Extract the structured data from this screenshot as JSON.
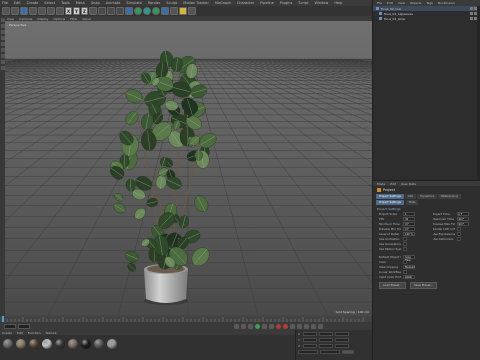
{
  "menubar": {
    "items": [
      "File",
      "Edit",
      "Create",
      "Select",
      "Tools",
      "Mesh",
      "Snap",
      "Animate",
      "Simulate",
      "Render",
      "Sculpt",
      "Motion Tracker",
      "MoGraph",
      "Character",
      "Pipeline",
      "Plugins",
      "Script",
      "Window",
      "Help"
    ]
  },
  "toolbar": {
    "x_label": "X",
    "y_label": "Y",
    "z_label": "Z"
  },
  "viewport": {
    "menu": [
      "View",
      "Cameras",
      "Display",
      "Options",
      "Filter",
      "Panel"
    ],
    "header_label": "Perspective",
    "status": "Grid Spacing : 100 cm"
  },
  "timeline": {
    "frame_field": "0 F",
    "end_field": "90 F"
  },
  "material_manager": {
    "menu": [
      "Create",
      "Edit",
      "Function",
      "Texture"
    ],
    "ball_colors": [
      "#6b6b6b",
      "#8a7a66",
      "#5b4a3a",
      "#c4c4c4",
      "#3a3a3a",
      "#7d6f5f",
      "#1b1b1b",
      "#5c5c5c",
      "#9a9a9a"
    ]
  },
  "coordinates": {
    "labels": [
      "X",
      "Y",
      "Z"
    ]
  },
  "object_manager": {
    "menu": [
      "File",
      "Edit",
      "View",
      "Objects",
      "Tags",
      "Bookmarks"
    ],
    "rows": [
      "Ficus_02_null",
      "ficus_02_bigLeaves",
      "ficus_02_lamp"
    ]
  },
  "attribute_manager": {
    "menu": [
      "Mode",
      "Edit",
      "User Data"
    ],
    "title": "Project",
    "tabs": [
      "Project Settings",
      "Info",
      "Dynamics",
      "Referencing"
    ],
    "subtabs": [
      "Project Settings",
      "Todo"
    ],
    "section": "Project Settings",
    "rows_left": [
      {
        "label": "Project Scale",
        "value": "1"
      },
      {
        "label": "FPS",
        "value": "30"
      },
      {
        "label": "Minimum Time",
        "value": "0 F"
      },
      {
        "label": "Preview Min Time",
        "value": "0 F"
      },
      {
        "label": "Level of Detail",
        "value": "100 %"
      },
      {
        "label": "Use Animation",
        "value": ""
      },
      {
        "label": "Use Generators",
        "value": ""
      },
      {
        "label": "Use Motion System",
        "value": ""
      }
    ],
    "rows_right": [
      {
        "label": "Project Time",
        "value": "0 F"
      },
      {
        "label": "Maximum Time",
        "value": "90 F"
      },
      {
        "label": "Preview Max Time",
        "value": "90 F"
      },
      {
        "label": "Render LOD in Editor",
        "value": ""
      },
      {
        "label": "Use Expressions",
        "value": ""
      },
      {
        "label": "Use Deformers",
        "value": ""
      }
    ],
    "lower_rows": [
      {
        "label": "Default Object Color",
        "value": "Gray Blue"
      },
      {
        "label": "Color",
        "value": ""
      },
      {
        "label": "View Clipping",
        "value": "Medium"
      },
      {
        "label": "Linear Workflow",
        "value": ""
      },
      {
        "label": "Input Color Profile",
        "value": "sRGB"
      }
    ],
    "buttons": [
      "Load Preset...",
      "Save Preset..."
    ]
  }
}
